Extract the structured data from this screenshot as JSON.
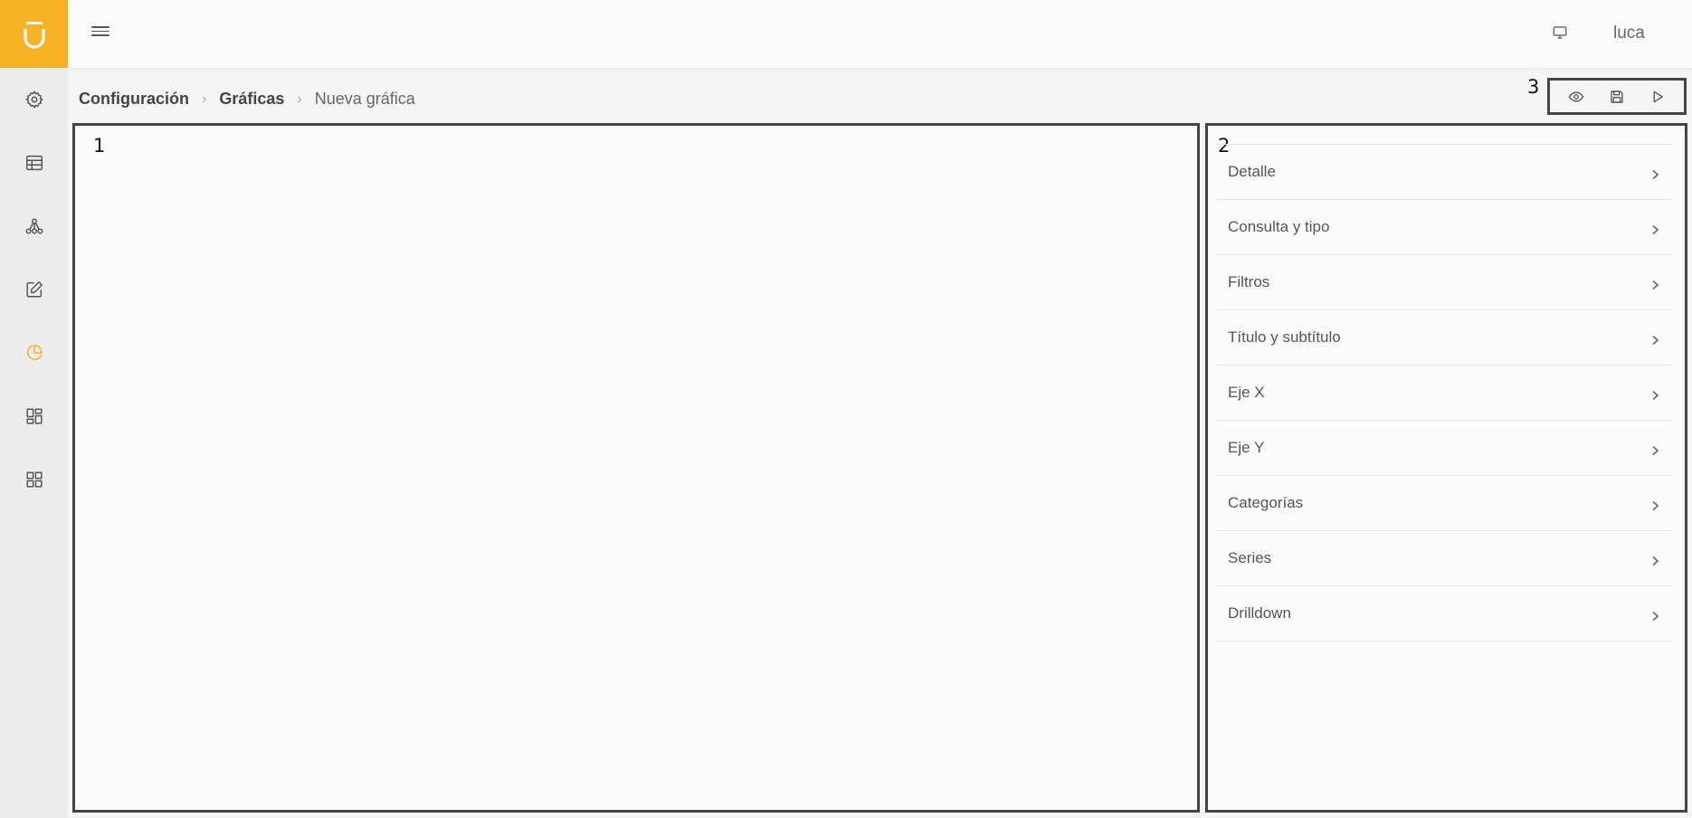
{
  "user": {
    "name": "luca"
  },
  "breadcrumb": {
    "items": [
      "Configuración",
      "Gráficas"
    ],
    "current": "Nueva gráfica"
  },
  "annotations": {
    "preview": "1",
    "config": "2",
    "toolbar": "3"
  },
  "config_panel": {
    "items": [
      "Detalle",
      "Consulta y tipo",
      "Filtros",
      "Título y subtítulo",
      "Eje X",
      "Eje Y",
      "Categorías",
      "Series",
      "Drilldown"
    ]
  },
  "sidebar": {
    "items": [
      {
        "icon": "gear-icon",
        "active": false
      },
      {
        "icon": "table-icon",
        "active": false
      },
      {
        "icon": "hierarchy-icon",
        "active": false
      },
      {
        "icon": "edit-icon",
        "active": false
      },
      {
        "icon": "pie-chart-icon",
        "active": true
      },
      {
        "icon": "dashboard-icon",
        "active": false
      },
      {
        "icon": "grid-icon",
        "active": false
      }
    ]
  },
  "toolbar": {
    "buttons": [
      "eye-icon",
      "save-icon",
      "play-icon"
    ]
  },
  "colors": {
    "accent": "#f7b225"
  }
}
